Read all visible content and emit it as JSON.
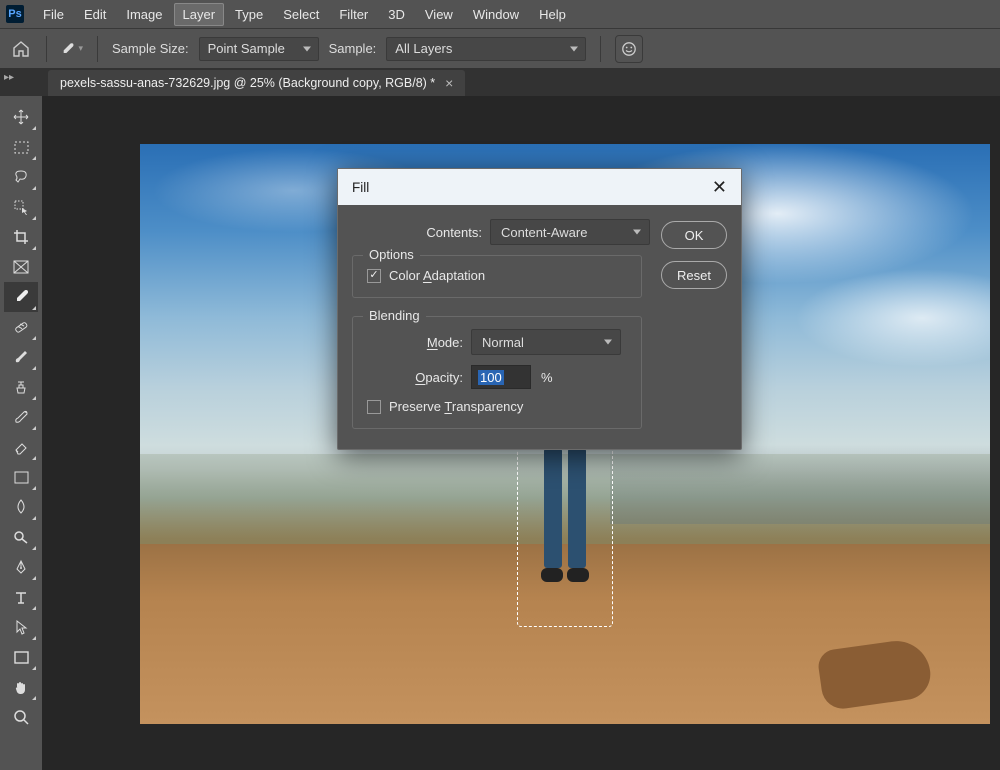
{
  "menubar": {
    "logo": "Ps",
    "items": [
      "File",
      "Edit",
      "Image",
      "Layer",
      "Type",
      "Select",
      "Filter",
      "3D",
      "View",
      "Window",
      "Help"
    ],
    "active_index": 3
  },
  "optionsbar": {
    "sample_size_label": "Sample Size:",
    "sample_size_value": "Point Sample",
    "sample_label": "Sample:",
    "sample_value": "All Layers"
  },
  "tab": {
    "title": "pexels-sassu-anas-732629.jpg @ 25% (Background copy, RGB/8) *"
  },
  "dialog": {
    "title": "Fill",
    "contents_label": "Contents:",
    "contents_value": "Content-Aware",
    "options_legend": "Options",
    "color_adaptation": "Color Adaptation",
    "color_adaptation_mnemonic": "A",
    "blending_legend": "Blending",
    "mode_label": "Mode:",
    "mode_mnemonic": "M",
    "mode_value": "Normal",
    "opacity_label": "Opacity:",
    "opacity_mnemonic": "O",
    "opacity_value": "100",
    "percent": "%",
    "preserve_transparency": "Preserve Transparency",
    "preserve_transparency_mnemonic": "T",
    "ok": "OK",
    "reset": "Reset"
  },
  "tools": [
    "move",
    "marquee",
    "lasso",
    "quick-select",
    "crop",
    "frame",
    "eyedropper",
    "healing",
    "brush",
    "clone",
    "history-brush",
    "eraser",
    "gradient",
    "blur",
    "dodge",
    "pen",
    "type",
    "path-select",
    "rectangle",
    "hand",
    "zoom"
  ],
  "active_tool_index": 6
}
